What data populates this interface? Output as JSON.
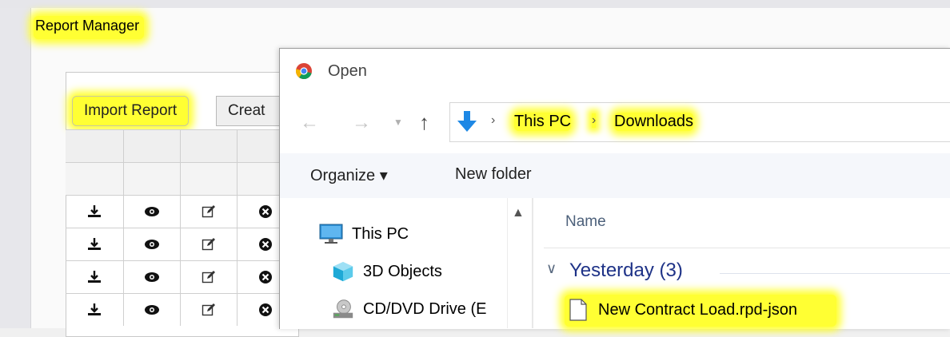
{
  "app": {
    "title": "Report Manager",
    "buttons": {
      "import": "Import Report",
      "create": "Creat"
    }
  },
  "dialog": {
    "title": "Open",
    "address": {
      "crumbs": [
        "This PC",
        "Downloads"
      ],
      "separator": "›"
    },
    "toolbar": {
      "organize": "Organize ▾",
      "new_folder": "New folder"
    },
    "nav_pane": {
      "items": [
        {
          "label": "This PC",
          "icon": "monitor-icon"
        },
        {
          "label": "3D Objects",
          "icon": "cube-icon"
        },
        {
          "label": "CD/DVD Drive (E",
          "icon": "cd-drive-icon"
        }
      ]
    },
    "file_list": {
      "column_header": "Name",
      "group": {
        "label": "Yesterday (3)"
      },
      "files": [
        {
          "name": "New Contract Load.rpd-json",
          "icon": "file-icon"
        }
      ]
    }
  },
  "colors": {
    "highlight": "#ffff33",
    "group_label": "#1e3287",
    "folder_arrow": "#1e88e5"
  }
}
